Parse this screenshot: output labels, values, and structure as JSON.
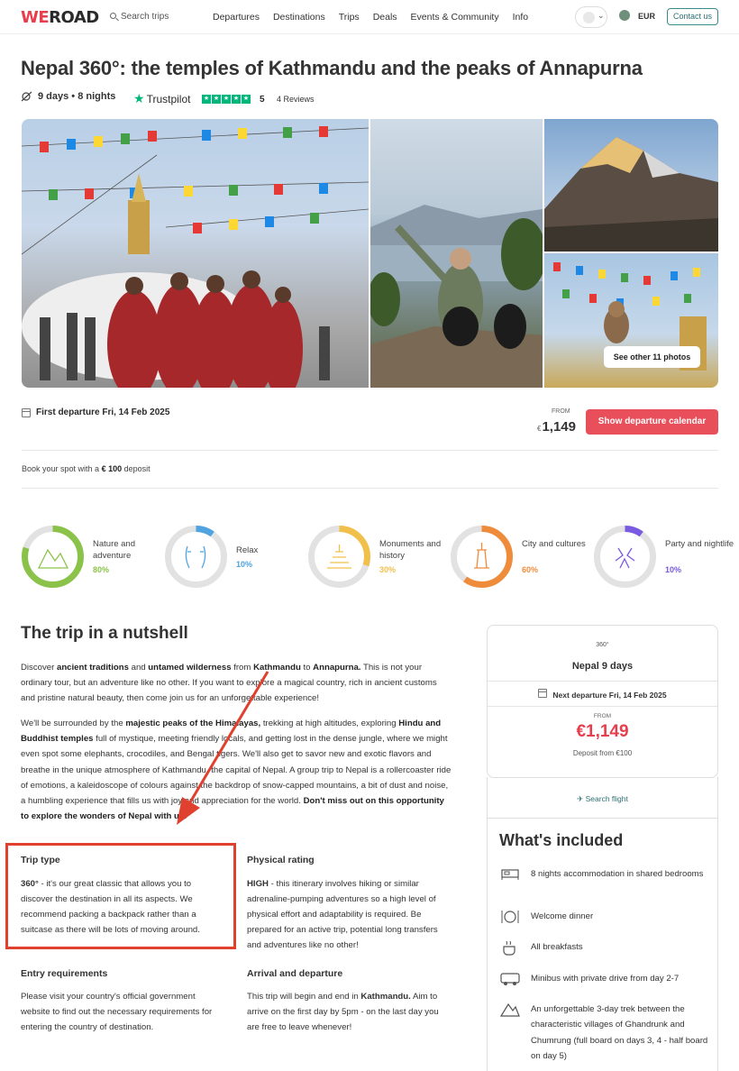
{
  "header": {
    "logo_we": "WE",
    "logo_road": "ROAD",
    "search_placeholder": "Search trips",
    "nav": [
      "Departures",
      "Destinations",
      "Trips",
      "Deals",
      "Events & Community",
      "Info"
    ],
    "currency": "EUR",
    "contact": "Contact us"
  },
  "trip": {
    "title": "Nepal 360°: the temples of Kathmandu and the peaks of Annapurna",
    "duration": "9 days • 8 nights",
    "trustpilot": "Trustpilot",
    "rating": "5",
    "reviews": "4 Reviews"
  },
  "gallery": {
    "see_more": "See other 11 photos"
  },
  "booking": {
    "first_departure": "First departure Fri, 14 Feb 2025",
    "from": "FROM",
    "currency_symbol": "€",
    "price": "1,149",
    "calendar_button": "Show departure calendar",
    "deposit_prefix": "Book your spot with a",
    "deposit_amount": "€ 100",
    "deposit_suffix": "deposit"
  },
  "categories": [
    {
      "label": "Nature and adventure",
      "pct": "80%",
      "value": 0.8,
      "color": "#8bc34a"
    },
    {
      "label": "Relax",
      "pct": "10%",
      "value": 0.1,
      "color": "#4fa3e0"
    },
    {
      "label": "Monuments and history",
      "pct": "30%",
      "value": 0.3,
      "color": "#f0c04a"
    },
    {
      "label": "City and cultures",
      "pct": "60%",
      "value": 0.6,
      "color": "#ef8c3c"
    },
    {
      "label": "Party and nightlife",
      "pct": "10%",
      "value": 0.1,
      "color": "#7a5ae0"
    }
  ],
  "nutshell": {
    "title": "The trip in a nutshell",
    "p1_a": "Discover ",
    "p1_b": "ancient traditions",
    "p1_c": " and ",
    "p1_d": "untamed wilderness",
    "p1_e": " from ",
    "p1_f": "Kathmandu",
    "p1_g": " to ",
    "p1_h": "Annapurna.",
    "p1_i": " This is not your ordinary tour, but an adventure like no other. If you want to explore a magical country, rich in ancient customs and pristine natural beauty, then come join us for an unforgettable experience!",
    "p2_a": "We'll be surrounded by the ",
    "p2_b": "majestic peaks of the Himalayas,",
    "p2_c": " trekking at high altitudes, exploring ",
    "p2_d": "Hindu and Buddhist temples",
    "p2_e": " full of mystique, meeting friendly locals, and getting lost in the dense jungle, where we might even spot some elephants, crocodiles, and Bengal tigers. We'll also get to savor new and exotic flavors and breathe in the unique atmosphere of Kathmandu, the capital of Nepal. A group trip to Nepal is a rollercoaster ride of emotions, a kaleidoscope of colours against the backdrop of snow-capped mountains, a bit of dust and noise, a humbling experience that fills us with joy and appreciation for the world. ",
    "p2_f": "Don't miss out on this opportunity to explore the wonders of Nepal with us!"
  },
  "facts": {
    "trip_type_head": "Trip type",
    "trip_type_bold": "360°",
    "trip_type_text": " - it's our great classic that allows you to discover the destination in all its aspects. We recommend packing a backpack rather than a suitcase as there will be lots of moving around.",
    "physical_head": "Physical rating",
    "physical_bold": "HIGH",
    "physical_text": " - this itinerary involves hiking or similar adrenaline-pumping adventures so a high level of physical effort and adaptability is required. Be prepared for an active trip, potential long transfers and adventures like no other!",
    "entry_head": "Entry requirements",
    "entry_text": "Please visit your country's official government website to find out the necessary requirements for entering the country of destination.",
    "arrival_head": "Arrival and departure",
    "arrival_a": "This trip will begin and end in ",
    "arrival_b": "Kathmandu.",
    "arrival_c": " Aim to arrive on the first day by 5pm - on the last day you are free to leave whenever!"
  },
  "card": {
    "type": "360°",
    "name": "Nepal 9 days",
    "next_departure": "Next departure Fri, 14 Feb 2025",
    "from": "FROM",
    "price": "€1,149",
    "deposit": "Deposit from  €100",
    "search_flight": "Search flight"
  },
  "included": {
    "title": "What's included",
    "items": [
      {
        "text": "8 nights accommodation in shared bedrooms",
        "icon": "bed-icon"
      },
      {
        "text": "Welcome dinner",
        "icon": "dinner-icon"
      },
      {
        "text": "All breakfasts",
        "icon": "coffee-icon"
      },
      {
        "text": "Minibus with private drive from day 2-7",
        "icon": "minibus-icon"
      },
      {
        "text": "An unforgettable 3-day trek between the characteristic villages of Ghandrunk and Chumrung (full board on days 3, 4 - half board on day 5)",
        "icon": "mountain-icon"
      }
    ]
  },
  "colors": {
    "brand": "#e63e4c",
    "teal": "#2d6f73",
    "annotation": "#e0412f"
  }
}
